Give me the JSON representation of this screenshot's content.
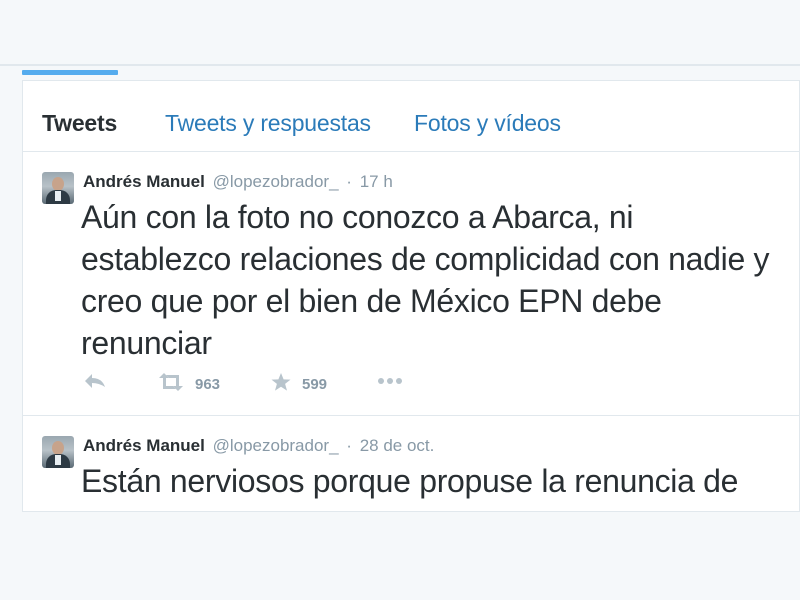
{
  "tabs": [
    {
      "label": "Tweets",
      "active": true
    },
    {
      "label": "Tweets y respuestas",
      "active": false
    },
    {
      "label": "Fotos y vídeos",
      "active": false
    }
  ],
  "tweets": [
    {
      "name": "Andrés Manuel",
      "handle": "@lopezobrador_",
      "separator": "·",
      "time": "17 h",
      "text": "Aún con la foto no conozco a Abarca, ni establezco relaciones de complicidad con nadie y creo que por el bien de México EPN debe renunciar",
      "retweets": "963",
      "favorites": "599",
      "icons": [
        "reply-icon",
        "retweet-icon",
        "star-icon",
        "more-icon"
      ]
    },
    {
      "name": "Andrés Manuel",
      "handle": "@lopezobrador_",
      "separator": "·",
      "time": "28 de oct.",
      "text": "Están nerviosos porque propuse la renuncia de"
    }
  ],
  "colors": {
    "accent": "#55acee",
    "link": "#2b7bb9",
    "text": "#292f33",
    "muted": "#8899a6",
    "border": "#e1e8ed",
    "background": "#f5f8fa"
  }
}
